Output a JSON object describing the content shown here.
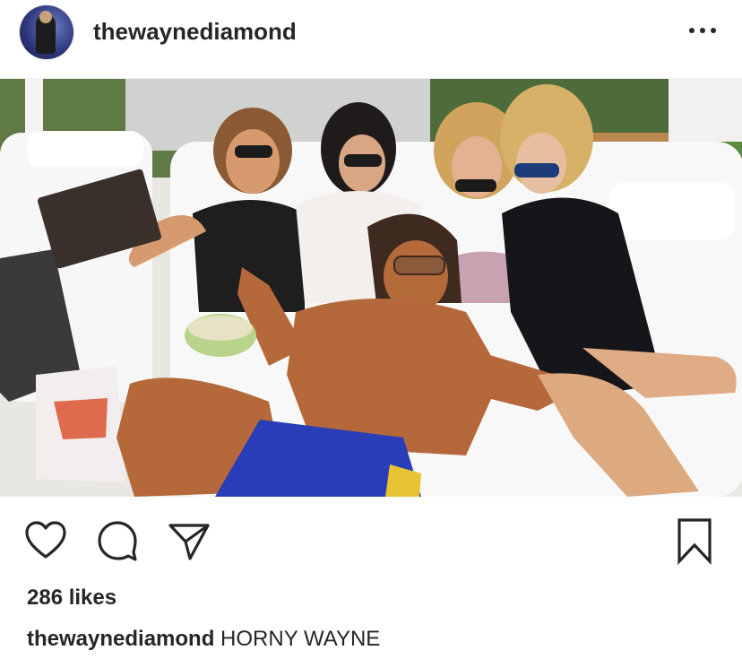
{
  "post": {
    "username": "thewaynediamond",
    "image_description_icon": "photo-icon",
    "likes": "286 likes",
    "caption": {
      "username": "thewaynediamond",
      "text": "HORNY WAYNE"
    },
    "icons": {
      "more": "more-options-icon",
      "like": "heart-icon",
      "comment": "comment-bubble-icon",
      "share": "paper-plane-icon",
      "save": "bookmark-icon"
    },
    "colors": {
      "text": "#262626",
      "divider": "#efefef",
      "icon": "#262626"
    }
  }
}
